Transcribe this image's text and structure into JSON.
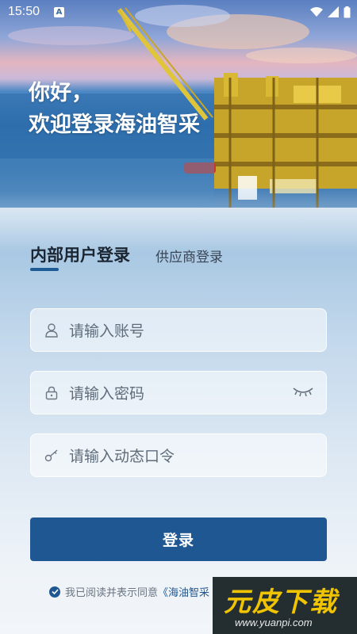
{
  "status_bar": {
    "time": "15:50",
    "notification_icon": "a-icon",
    "icons": [
      "wifi-icon",
      "signal-icon",
      "battery-icon"
    ]
  },
  "hero": {
    "greeting_line1": "你好，",
    "greeting_line2": "欢迎登录海油智采",
    "image": "offshore-oil-platform-photo"
  },
  "tabs": [
    {
      "label": "内部用户登录",
      "active": true
    },
    {
      "label": "供应商登录",
      "active": false
    }
  ],
  "form": {
    "account_placeholder": "请输入账号",
    "password_placeholder": "请输入密码",
    "otp_placeholder": "请输入动态口令",
    "account_icon": "user-icon",
    "password_icon": "lock-icon",
    "otp_icon": "key-icon",
    "toggle_icon": "eye-closed-icon"
  },
  "login_button": "登录",
  "agreement": {
    "text": "我已阅读并表示同意",
    "link": "《海油智采"
  },
  "watermark": {
    "main": "元皮下载",
    "sub": "www.yuanpi.com"
  },
  "colors": {
    "primary": "#1f5793",
    "tab_underline": "#1e5a94",
    "watermark_text": "#f0c400"
  }
}
